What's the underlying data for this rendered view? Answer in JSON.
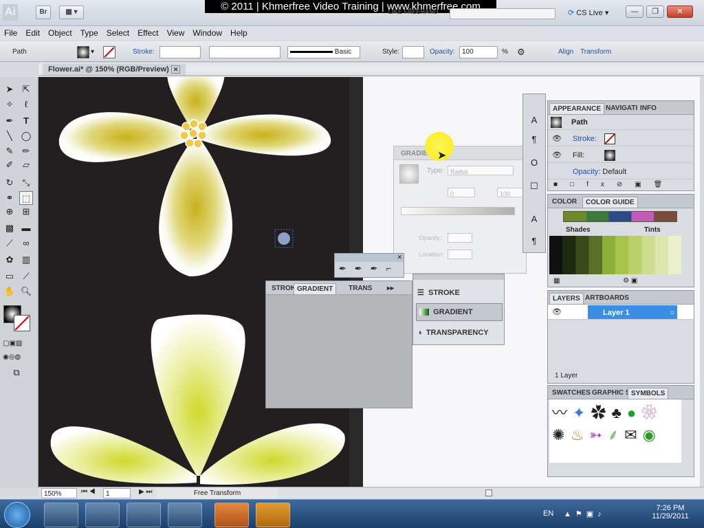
{
  "app": {
    "logo": "Ai",
    "bridge": "Br",
    "workspace": "LIKE FREEHAND",
    "cs_live": "CS Live",
    "watermark": "© 2011 | Khmerfree Video Training | www.khmerfree.com"
  },
  "menu": [
    "File",
    "Edit",
    "Object",
    "Type",
    "Select",
    "Effect",
    "View",
    "Window",
    "Help"
  ],
  "control": {
    "path_label": "Path",
    "stroke_label": "Stroke:",
    "style_label": "Style:",
    "stroke_profile": "Basic",
    "opacity_label": "Opacity:",
    "opacity_value": "100",
    "opacity_unit": "%",
    "align": "Align",
    "transform": "Transform"
  },
  "document": {
    "tab": "Flower.ai* @ 150% (RGB/Preview)"
  },
  "gradient_panel": {
    "title": "GRADIENT",
    "type_label": "Type:",
    "type_value": "Radial",
    "angle": "0",
    "ratio": "100",
    "opacity_label": "Opacity:",
    "location_label": "Location:",
    "unit": "%"
  },
  "floating_panel": {
    "tabs": [
      "STROK",
      "GRADIENT",
      "TRANS"
    ]
  },
  "panel_menu": {
    "items": [
      "STROKE",
      "GRADIENT",
      "TRANSPARENCY"
    ],
    "selected": "GRADIENT"
  },
  "appearance": {
    "tabs": [
      "APPEARANCE",
      "NAVIGATI",
      "INFO"
    ],
    "path": "Path",
    "stroke": "Stroke:",
    "fill": "Fill:",
    "opacity": "Opacity:",
    "opacity_value": "Default"
  },
  "color": {
    "tabs": [
      "COLOR",
      "COLOR GUIDE"
    ],
    "shades": "Shades",
    "tints": "Tints"
  },
  "layers": {
    "tabs": [
      "LAYERS",
      "ARTBOARDS"
    ],
    "layer": "Layer 1",
    "count": "1 Layer"
  },
  "symbols": {
    "tabs": [
      "SWATCHES",
      "GRAPHIC S",
      "SYMBOLS"
    ]
  },
  "status": {
    "zoom": "150%",
    "page": "1",
    "tool": "Free Transform"
  },
  "taskbar": {
    "lang": "EN",
    "time": "7:26 PM",
    "date": "11/29/2011"
  },
  "colors": {
    "accent": "#1c4fb5",
    "layer_highlight": "#3a8ee6",
    "flower_yellow": "#c9c21a"
  }
}
